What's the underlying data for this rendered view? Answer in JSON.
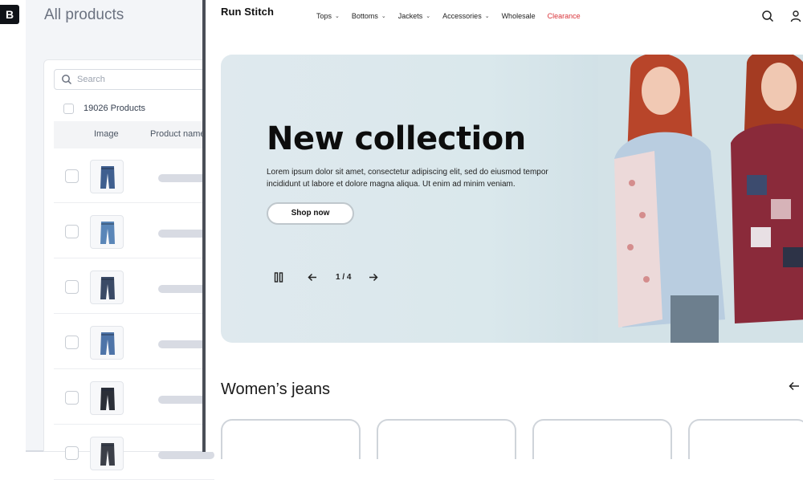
{
  "admin": {
    "logo": "B",
    "title": "All products",
    "search_placeholder": "Search",
    "product_count": "19026 Products",
    "columns": [
      "Image",
      "Product name"
    ],
    "rows": [
      {
        "jean_color": "#3f5f8f"
      },
      {
        "jean_color": "#5a86b8"
      },
      {
        "jean_color": "#3a4a66"
      },
      {
        "jean_color": "#4e74a8"
      },
      {
        "jean_color": "#2b2f38"
      },
      {
        "jean_color": "#3b3f48"
      }
    ]
  },
  "store": {
    "brand": "Run Stitch",
    "nav": [
      {
        "label": "Tops",
        "dropdown": true
      },
      {
        "label": "Bottoms",
        "dropdown": true
      },
      {
        "label": "Jackets",
        "dropdown": true
      },
      {
        "label": "Accessories",
        "dropdown": true
      },
      {
        "label": "Wholesale",
        "dropdown": false
      },
      {
        "label": "Clearance",
        "dropdown": false,
        "color": "#d9343a"
      }
    ],
    "hero": {
      "title": "New collection",
      "description": "Lorem ipsum dolor sit amet, consectetur adipiscing elit, sed do eiusmod tempor incididunt ut labore et dolore magna aliqua. Ut enim ad minim veniam.",
      "button": "Shop now",
      "pager": "1 / 4"
    },
    "section_title": "Women’s jeans"
  }
}
